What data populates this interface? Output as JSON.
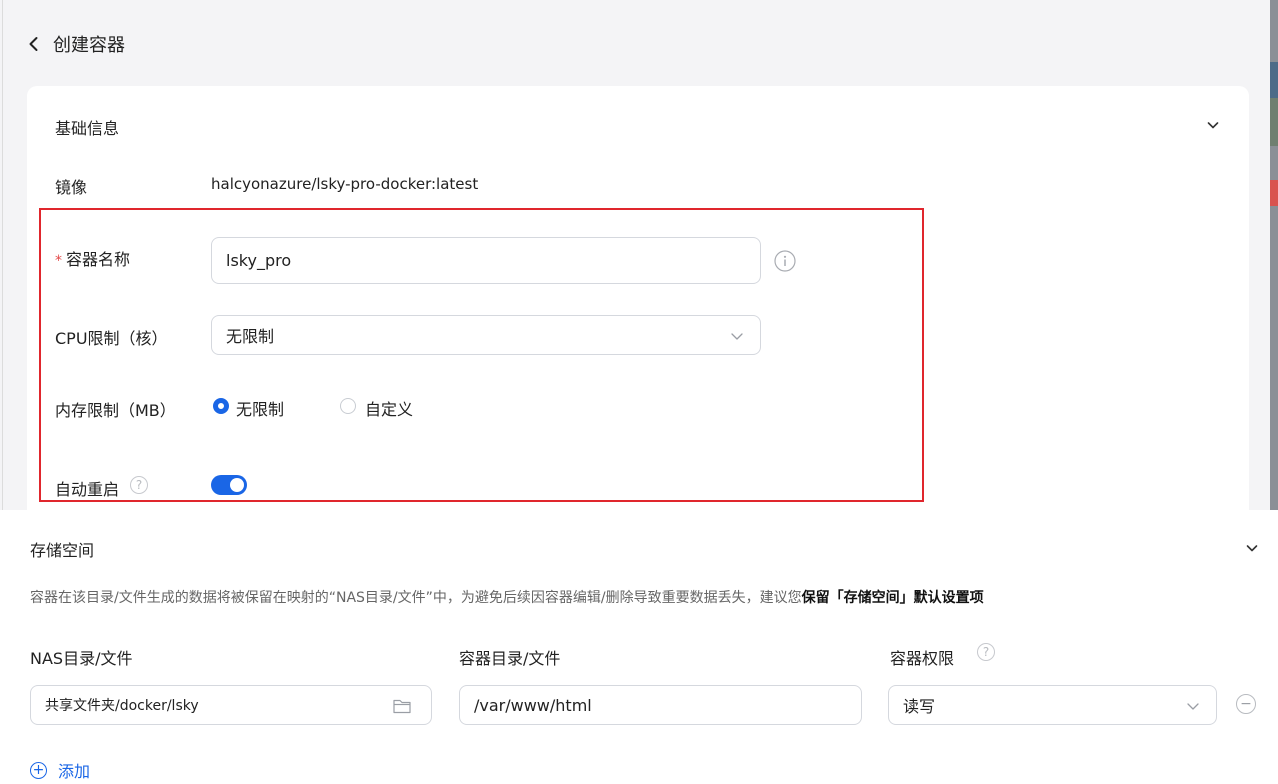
{
  "header": {
    "title": "创建容器"
  },
  "basic": {
    "section_title": "基础信息",
    "image_label": "镜像",
    "image_value": "halcyonazure/lsky-pro-docker:latest",
    "name_label": "容器名称",
    "name_required_mark": "*",
    "name_value": "lsky_pro",
    "cpu_label": "CPU限制（核）",
    "cpu_value": "无限制",
    "memory_label": "内存限制（MB）",
    "memory_options": [
      {
        "label": "无限制",
        "selected": true
      },
      {
        "label": "自定义",
        "selected": false
      }
    ],
    "restart_label": "自动重启",
    "restart_enabled": true
  },
  "storage": {
    "section_title": "存储空间",
    "desc_prefix": "容器在该目录/文件生成的数据将被保留在映射的“NAS目录/文件”中，为避免后续因容器编辑/删除导致重要数据丢失，建议您",
    "desc_bold": "保留「存储空间」默认设置项",
    "col_nas": "NAS目录/文件",
    "col_container": "容器目录/文件",
    "col_permission": "容器权限",
    "rows": [
      {
        "nas_path": "共享文件夹/docker/lsky",
        "container_path": "/var/www/html",
        "permission": "读写"
      }
    ],
    "add_label": "添加"
  },
  "colors": {
    "accent": "#1a66e6",
    "highlight_border": "#e0262d",
    "required": "#e34848"
  },
  "icons": [
    "chevron-left-icon",
    "chevron-down-icon",
    "info-icon",
    "help-icon",
    "folder-icon",
    "plus-circle-icon",
    "minus-circle-icon"
  ]
}
